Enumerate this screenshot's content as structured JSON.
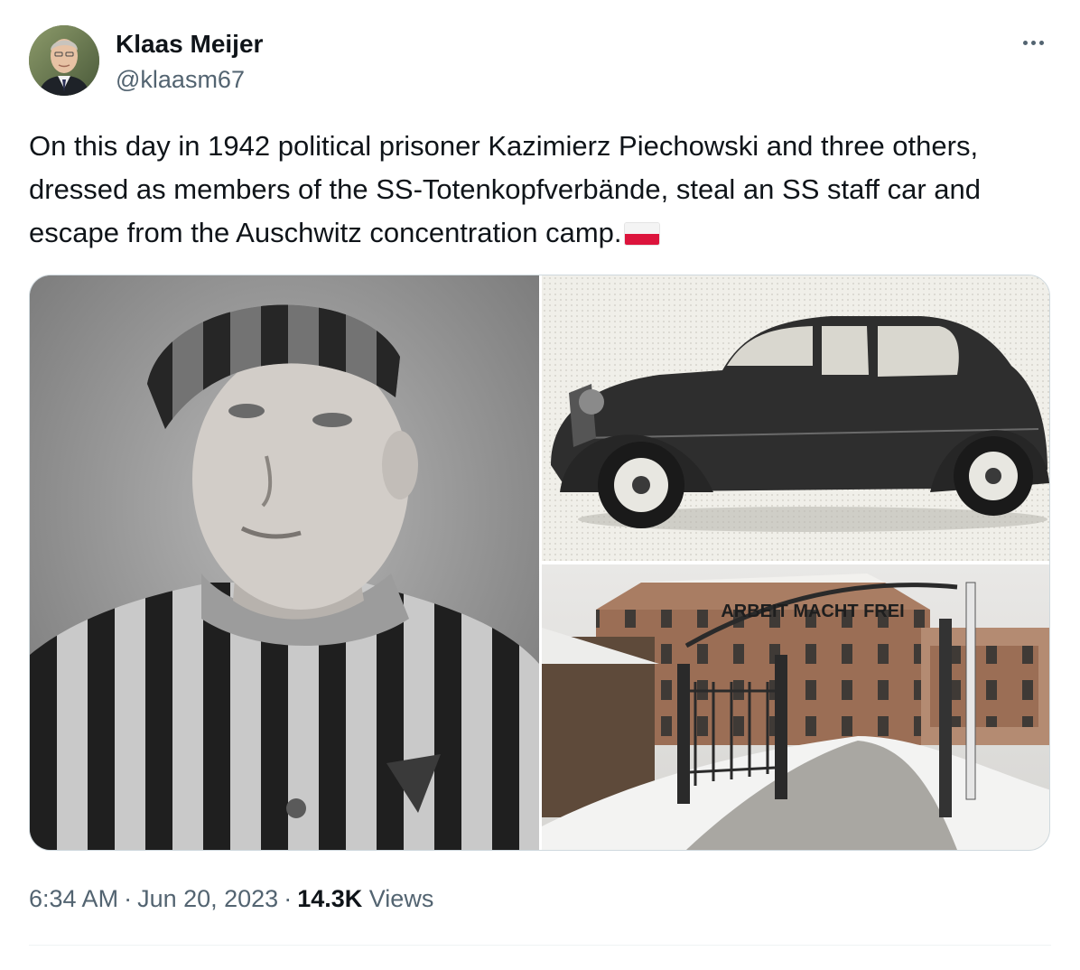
{
  "author": {
    "display_name": "Klaas Meijer",
    "handle": "@klaasm67",
    "avatar_icon": "profile-photo"
  },
  "more_icon": "ellipsis-icon",
  "tweet": {
    "text": "On this day in 1942 political prisoner Kazimierz Piechowski and three others, dressed as members of the SS-Totenkopfverbände, steal an SS staff car and escape from the Auschwitz concentration camp.",
    "emoji": "flag-poland",
    "flag_colors": {
      "top": "#f4f4f4",
      "bottom": "#dc143c"
    }
  },
  "media": [
    {
      "name": "prisoner-portrait-photo",
      "description_icon": "portrait-photo"
    },
    {
      "name": "staff-car-photo",
      "description_icon": "car-photo"
    },
    {
      "name": "auschwitz-gate-photo",
      "description_icon": "gate-photo",
      "sign_text": "ARBEIT MACHT FREI"
    }
  ],
  "meta": {
    "time": "6:34 AM",
    "separator": "·",
    "date": "Jun 20, 2023",
    "views_count": "14.3K",
    "views_label": "Views"
  },
  "colors": {
    "text_primary": "#0f1419",
    "text_secondary": "#536471",
    "border": "#cfd9de"
  }
}
